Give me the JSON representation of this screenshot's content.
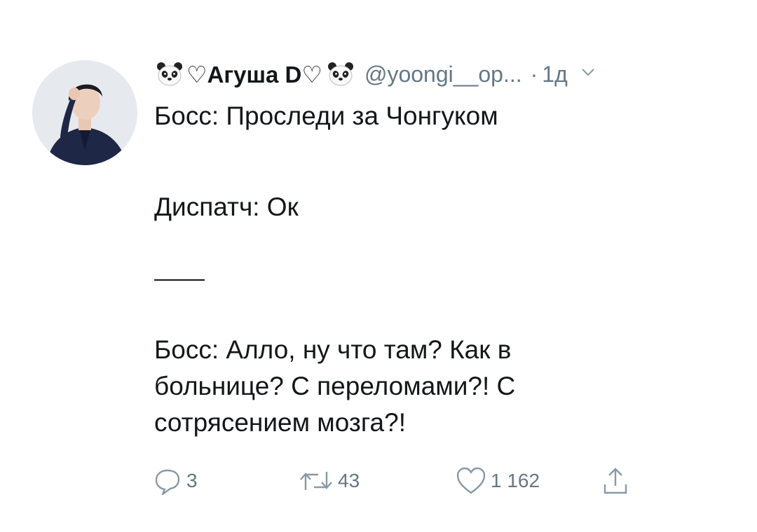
{
  "tweet": {
    "author": {
      "display_name": "♡Агуша D♡",
      "handle": "@yoongi__op...",
      "time": "1д",
      "name_emoji_icon": "panda-face-icon"
    },
    "text_lines": [
      "Босс: Проследи за Чонгуком",
      "",
      "Диспатч: Ок",
      "",
      "",
      "",
      "Босс: Алло, ну что там? Как в",
      "больнице? С переломами?! С",
      "сотрясением мозга?!"
    ],
    "actions": {
      "reply": {
        "icon": "reply-icon",
        "count": "3"
      },
      "retweet": {
        "icon": "retweet-icon",
        "count": "43"
      },
      "like": {
        "icon": "heart-icon",
        "count": "1 162"
      },
      "share": {
        "icon": "share-icon",
        "count": ""
      }
    },
    "colors": {
      "text": "#14171a",
      "secondary": "#657786",
      "background": "#ffffff"
    }
  }
}
